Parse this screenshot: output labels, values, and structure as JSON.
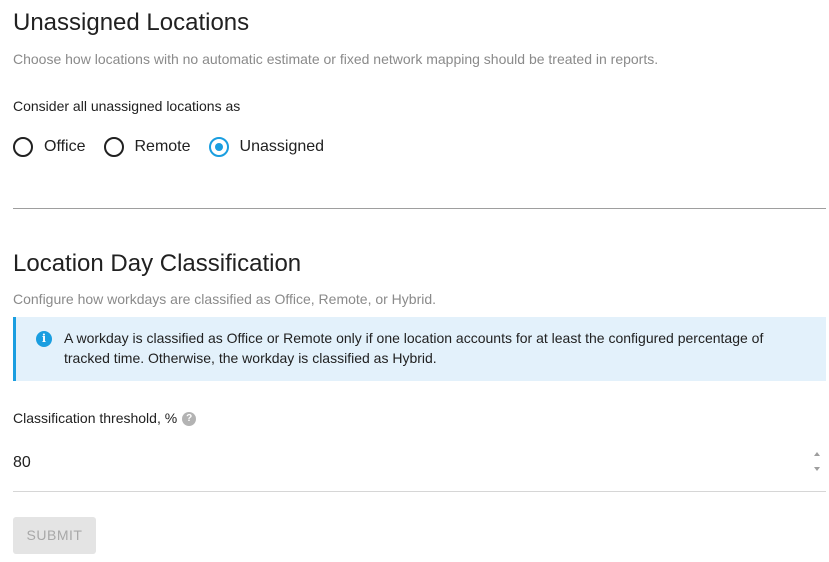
{
  "unassigned": {
    "title": "Unassigned Locations",
    "description": "Choose how locations with no automatic estimate or fixed network mapping should be treated in reports.",
    "label": "Consider all unassigned locations as",
    "options": [
      {
        "label": "Office",
        "selected": false
      },
      {
        "label": "Remote",
        "selected": false
      },
      {
        "label": "Unassigned",
        "selected": true
      }
    ]
  },
  "classification": {
    "title": "Location Day Classification",
    "description": "Configure how workdays are classified as Office, Remote, or Hybrid.",
    "info_icon": "info-icon",
    "info_text": "A workday is classified as Office or Remote only if one location accounts for at least the configured percentage of tracked time. Otherwise, the workday is classified as Hybrid.",
    "threshold_label": "Classification threshold, %",
    "help_icon": "question-icon",
    "threshold_value": "80"
  },
  "submit_label": "SUBMIT",
  "colors": {
    "accent": "#1a9ee0",
    "info_bg": "#e3f1fb",
    "muted_text": "#8a8a8a"
  }
}
